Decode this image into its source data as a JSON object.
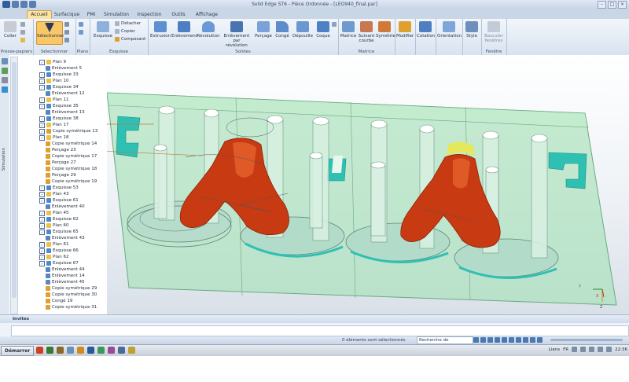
{
  "window": {
    "title": "Solid Edge ST6 - Pièce Ordonnée - [LEO940_final.par]"
  },
  "tabs": [
    "Accueil",
    "Surfacique",
    "PMI",
    "Simulation",
    "Inspection",
    "Outils",
    "Affichage"
  ],
  "ribbon": {
    "clipboard": {
      "paste": "Coller",
      "label": "Presse-papiers"
    },
    "select": {
      "button": "Sélectionner",
      "label": "Sélectionner"
    },
    "planes": {
      "label": "Plans"
    },
    "sketch": {
      "sketch": "Esquisse",
      "detach": "Détacher",
      "copy": "Copier",
      "component": "Composant",
      "label": "Esquisse"
    },
    "solids": {
      "extrusion": "Extrusion",
      "removal": "Enlèvement",
      "revolution": "Révolution",
      "removal_rev_1": "Enlèvement par",
      "removal_rev_2": "révolution",
      "hole": "Perçage",
      "round": "Congé",
      "draft": "Dépouille",
      "shell": "Coque",
      "label": "Solides"
    },
    "pattern": {
      "matrix": "Matrice",
      "curve_1": "Suivant",
      "curve_2": "courbe",
      "mirror": "Symétrie",
      "label": "Matrice"
    },
    "modify": {
      "modify": "Modifier",
      "dimension": "Cotation",
      "orientation": "Orientation",
      "style": "Style"
    },
    "window_group": {
      "switch_1": "Basculer",
      "switch_2": "fenêtres",
      "label": "Fenêtre"
    }
  },
  "leftbar": {
    "vertical": "Simulation"
  },
  "tree": [
    {
      "label": "Plan 9",
      "icon": "plane",
      "checked": true
    },
    {
      "label": "Enlèvement 5",
      "icon": "feature",
      "checked": false
    },
    {
      "label": "Esquisse 33",
      "icon": "sketch",
      "checked": true
    },
    {
      "label": "Plan 10",
      "icon": "plane",
      "checked": true
    },
    {
      "label": "Esquisse 34",
      "icon": "sketch",
      "checked": true
    },
    {
      "label": "Enlèvement 12",
      "icon": "feature",
      "checked": false
    },
    {
      "label": "Plan 11",
      "icon": "plane",
      "checked": true
    },
    {
      "label": "Esquisse 35",
      "icon": "sketch",
      "checked": true
    },
    {
      "label": "Enlèvement 13",
      "icon": "feature",
      "checked": false
    },
    {
      "label": "Esquisse 38",
      "icon": "sketch",
      "checked": true
    },
    {
      "label": "Plan 17",
      "icon": "plane",
      "checked": true
    },
    {
      "label": "Copie symétrique 13",
      "icon": "mirror",
      "checked": true
    },
    {
      "label": "Plan 18",
      "icon": "plane",
      "checked": true
    },
    {
      "label": "Copie symétrique 14",
      "icon": "mirror",
      "checked": false
    },
    {
      "label": "Perçage 23",
      "icon": "hole",
      "checked": false
    },
    {
      "label": "Copie symétrique 17",
      "icon": "mirror",
      "checked": false
    },
    {
      "label": "Perçage 27",
      "icon": "hole",
      "checked": false
    },
    {
      "label": "Copie symétrique 18",
      "icon": "mirror",
      "checked": false
    },
    {
      "label": "Perçage 29",
      "icon": "hole",
      "checked": false
    },
    {
      "label": "Copie symétrique 19",
      "icon": "mirror",
      "checked": false
    },
    {
      "label": "Esquisse 53",
      "icon": "sketch",
      "checked": true
    },
    {
      "label": "Plan 43",
      "icon": "plane",
      "checked": true
    },
    {
      "label": "Esquisse 61",
      "icon": "sketch",
      "checked": true
    },
    {
      "label": "Enlèvement 40",
      "icon": "feature",
      "checked": false
    },
    {
      "label": "Plan 45",
      "icon": "plane",
      "checked": true
    },
    {
      "label": "Esquisse 62",
      "icon": "sketch",
      "checked": true
    },
    {
      "label": "Plan 60",
      "icon": "plane",
      "checked": true
    },
    {
      "label": "Esquisse 65",
      "icon": "sketch",
      "checked": true
    },
    {
      "label": "Enlèvement 43",
      "icon": "feature",
      "checked": false
    },
    {
      "label": "Plan 61",
      "icon": "plane",
      "checked": true
    },
    {
      "label": "Esquisse 66",
      "icon": "sketch",
      "checked": true
    },
    {
      "label": "Plan 62",
      "icon": "plane",
      "checked": true
    },
    {
      "label": "Esquisse 67",
      "icon": "sketch",
      "checked": true
    },
    {
      "label": "Enlèvement 44",
      "icon": "feature",
      "checked": false
    },
    {
      "label": "Enlèvement 14",
      "icon": "feature",
      "checked": false
    },
    {
      "label": "Enlèvement 45",
      "icon": "feature",
      "checked": false
    },
    {
      "label": "Copie symétrique 29",
      "icon": "mirror",
      "checked": false
    },
    {
      "label": "Copie symétrique 30",
      "icon": "mirror",
      "checked": false
    },
    {
      "label": "Congé 19",
      "icon": "round",
      "checked": false
    },
    {
      "label": "Copie symétrique 31",
      "icon": "mirror",
      "checked": false
    }
  ],
  "triad": {
    "x": "X",
    "y": "Y",
    "z": "Z"
  },
  "command_bar": {
    "title": "Invites"
  },
  "status": {
    "message": "0 éléments sont sélectionnés",
    "search": "Recherche de commande"
  },
  "taskbar": {
    "start": "Démarrer",
    "language": "FR",
    "links": "Liens",
    "clock": "22:36"
  },
  "colors": {
    "ribbon_accent": "#f7c768",
    "model_green": "#9fd9b0",
    "model_cyan": "#2fc0b4",
    "model_red": "#c83a12"
  }
}
